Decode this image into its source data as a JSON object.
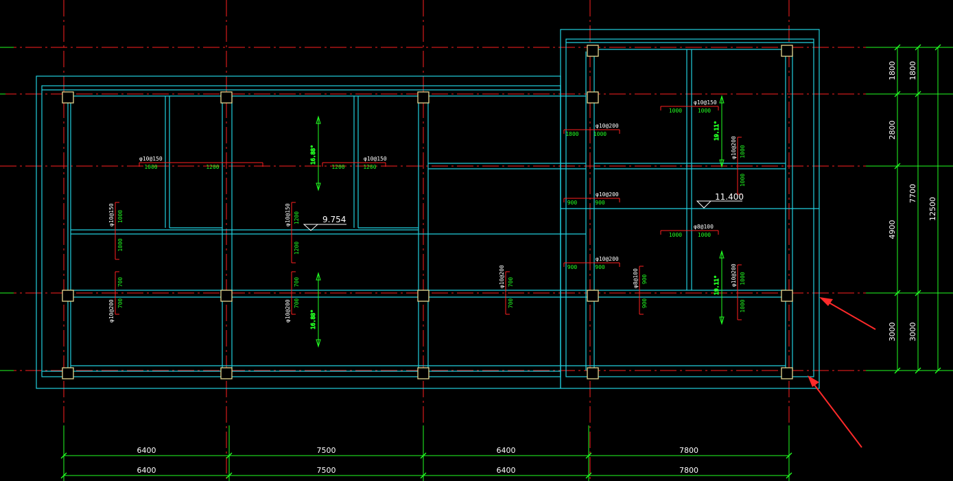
{
  "colors": {
    "background": "#000000",
    "axis": "#ff2020",
    "wall": "#22d0e0",
    "dimension": "#22ff22",
    "column": "#e8d890",
    "text": "#ffffff",
    "rebar_len": "#22ff22",
    "arrow": "#ff2a2a"
  },
  "bottom_dimensions": {
    "row1": [
      "6400",
      "7500",
      "6400",
      "7800"
    ],
    "row2": [
      "6400",
      "7500",
      "6400",
      "7800"
    ]
  },
  "right_dimensions": {
    "col1": [
      "1800",
      "2800",
      "4900",
      "3000"
    ],
    "col2": [
      "1800",
      "7700",
      "3000"
    ],
    "total": "12500"
  },
  "elevations": [
    "9.754",
    "11.400"
  ],
  "slope_angles": [
    "16.88°",
    "16.88°",
    "19.11°",
    "19.11°"
  ],
  "rebar_labels": [
    "φ10@150",
    "φ10@150",
    "φ10@150",
    "φ10@200",
    "φ10@200",
    "φ10@200",
    "φ10@150",
    "φ8@100",
    "φ10@200",
    "φ8@100",
    "φ10@150",
    "φ10@200",
    "φ10@200",
    "φ10@200",
    "φ10@200",
    "φ10@200"
  ],
  "rebar_lengths": [
    "1000",
    "1200",
    "1200",
    "1200",
    "1000",
    "1000",
    "1800",
    "1000",
    "1000",
    "1000",
    "1000",
    "1000",
    "900",
    "900",
    "1000",
    "1000",
    "900",
    "900",
    "1000",
    "1000",
    "1200",
    "1200",
    "700",
    "700",
    "700",
    "700",
    "700",
    "700",
    "900",
    "900",
    "1000",
    "1000"
  ],
  "icons": [
    "annotation-arrow",
    "annotation-arrow"
  ]
}
